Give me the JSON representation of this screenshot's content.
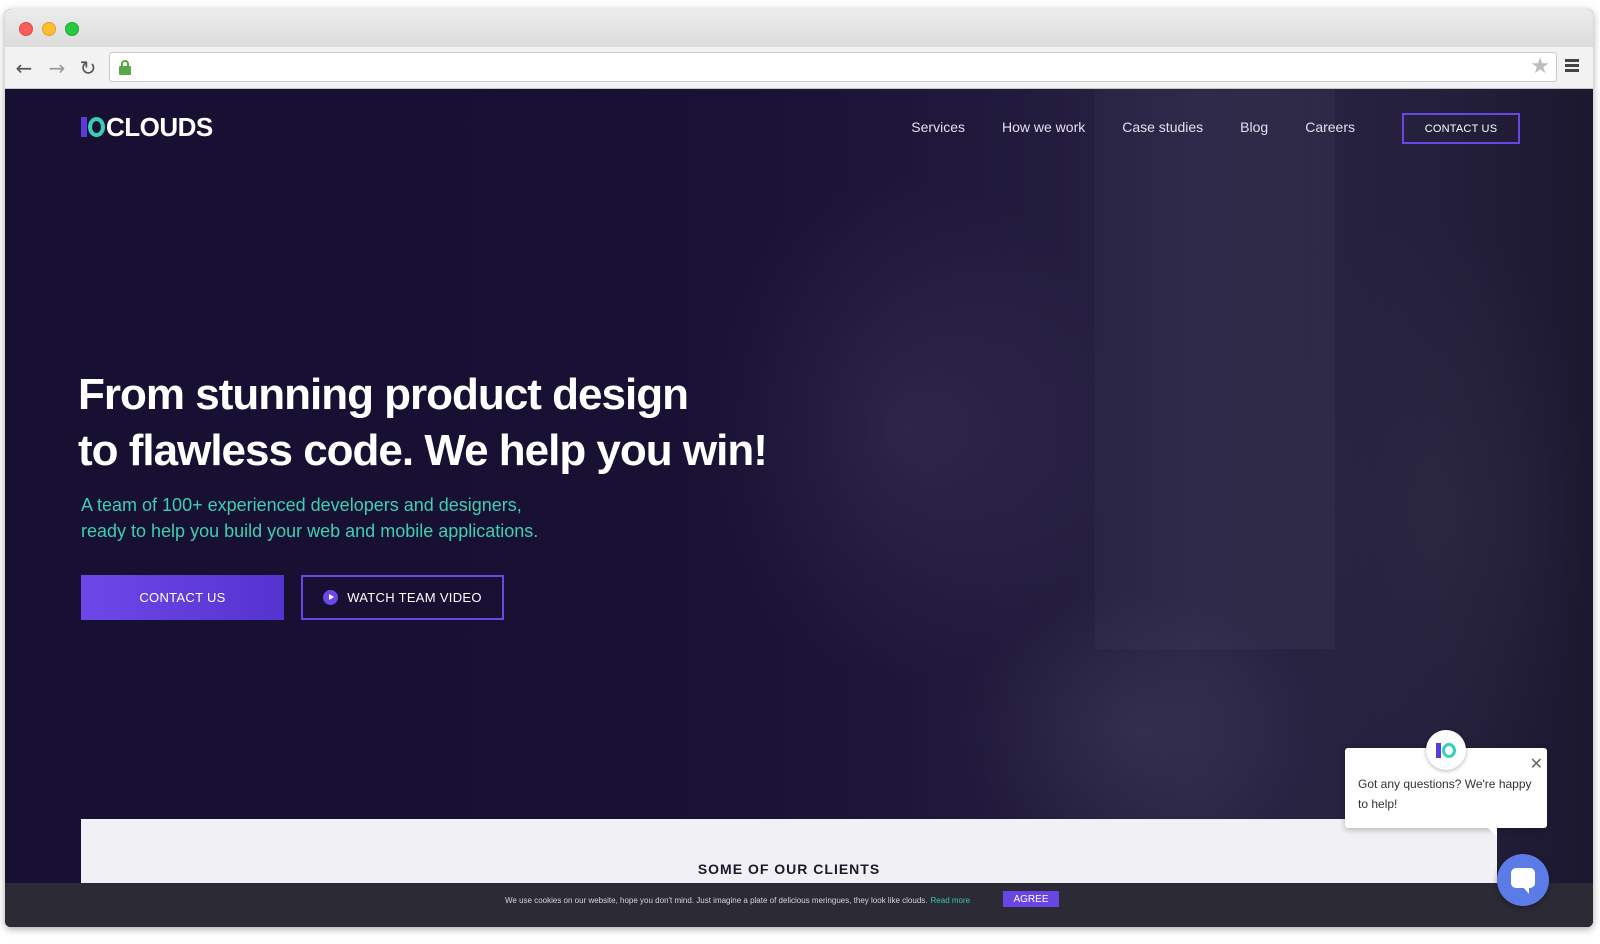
{
  "browser": {
    "url": ""
  },
  "site": {
    "logo_text": "CLOUDS",
    "nav": [
      {
        "label": "Services"
      },
      {
        "label": "How we work"
      },
      {
        "label": "Case studies"
      },
      {
        "label": "Blog"
      },
      {
        "label": "Careers"
      }
    ],
    "nav_contact_label": "CONTACT US"
  },
  "hero": {
    "title_line1": "From stunning product design",
    "title_line2": "to flawless code. We help you win!",
    "subtitle_line1": "A team of 100+ experienced developers and designers,",
    "subtitle_line2": "ready to help you build your web and mobile applications.",
    "primary_button": "CONTACT US",
    "video_button": "WATCH TEAM VIDEO"
  },
  "clients": {
    "title": "SOME OF OUR CLIENTS"
  },
  "chat": {
    "message": "Got any questions? We're happy to help!",
    "close_glyph": "✕"
  },
  "cookie": {
    "text": "We use cookies on our website, hope you don't mind. Just imagine a plate of delicious meringues, they look like clouds.",
    "read_more": "Read more",
    "agree": "AGREE"
  },
  "colors": {
    "accent_purple": "#6b46e6",
    "accent_teal": "#3ccfb0",
    "hero_background": "#1a1133"
  },
  "icons": {
    "back": "arrow-left",
    "forward": "arrow-right",
    "reload": "reload",
    "secure": "lock",
    "bookmark": "star",
    "menu": "hamburger"
  }
}
